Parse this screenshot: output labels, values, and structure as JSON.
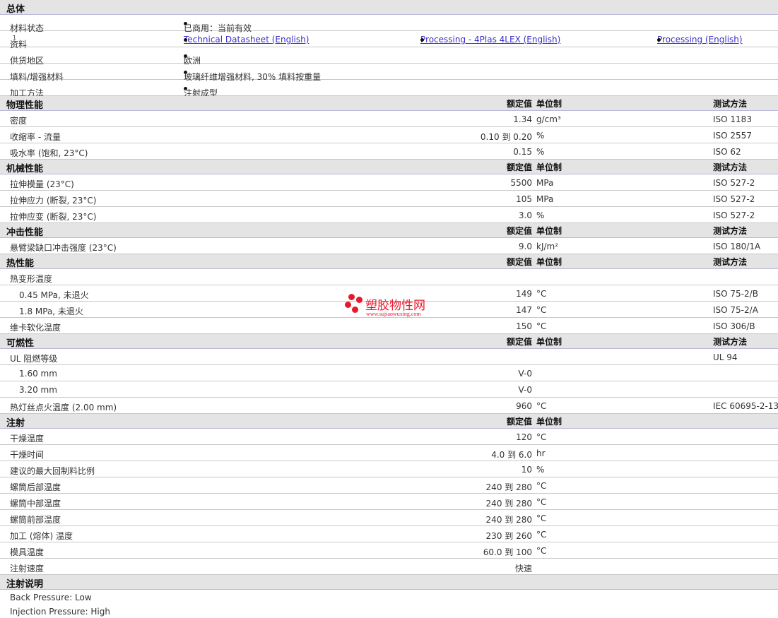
{
  "general": {
    "title": "总体",
    "rows": [
      {
        "label": "材料状态",
        "items": [
          {
            "text": "已商用：当前有效"
          }
        ]
      },
      {
        "label": "资料",
        "sup": "1",
        "items": [
          {
            "text": "Technical Datasheet (English)",
            "link": true
          },
          {
            "text": "Processing - 4Plas 4LEX (English)",
            "link": true
          },
          {
            "text": "Processing (English)",
            "link": true
          }
        ]
      },
      {
        "label": "供货地区",
        "items": [
          {
            "text": "欧洲"
          }
        ]
      },
      {
        "label": "填料/增强材料",
        "items": [
          {
            "text": "玻璃纤维增强材料, 30% 填料按重量"
          }
        ]
      },
      {
        "label": "加工方法",
        "items": [
          {
            "text": "注射成型"
          }
        ]
      }
    ]
  },
  "headers": {
    "value": "额定值",
    "unit": "单位制",
    "method": "测试方法"
  },
  "sections": [
    {
      "title": "物理性能",
      "method": true,
      "rows": [
        {
          "name": "密度",
          "value": "1.34",
          "unit": "g/cm³",
          "method": "ISO 1183"
        },
        {
          "name": "收缩率 - 流量",
          "value": "0.10 到  0.20",
          "unit": "%",
          "method": "ISO 2557"
        },
        {
          "name": "吸水率 (饱和, 23°C)",
          "value": "0.15",
          "unit": "%",
          "method": "ISO 62"
        }
      ]
    },
    {
      "title": "机械性能",
      "method": true,
      "rows": [
        {
          "name": "拉伸模量 (23°C)",
          "value": "5500",
          "unit": "MPa",
          "method": "ISO 527-2"
        },
        {
          "name": "拉伸应力 (断裂, 23°C)",
          "value": "105",
          "unit": "MPa",
          "method": "ISO 527-2"
        },
        {
          "name": "拉伸应变 (断裂, 23°C)",
          "value": "3.0",
          "unit": "%",
          "method": "ISO 527-2"
        }
      ]
    },
    {
      "title": "冲击性能",
      "method": true,
      "rows": [
        {
          "name": "悬臂梁缺口冲击强度 (23°C)",
          "value": "9.0",
          "unit": "kJ/m²",
          "method": "ISO 180/1A"
        }
      ]
    },
    {
      "title": "热性能",
      "method": true,
      "rows": [
        {
          "name": "热变形温度",
          "value": "",
          "unit": "",
          "method": ""
        },
        {
          "name": "0.45 MPa, 未退火",
          "sub": true,
          "value": "149",
          "unit": "°C",
          "method": "ISO 75-2/B"
        },
        {
          "name": "1.8 MPa, 未退火",
          "sub": true,
          "value": "147",
          "unit": "°C",
          "method": "ISO 75-2/A"
        },
        {
          "name": "维卡软化温度",
          "value": "150",
          "unit": "°C",
          "method": "ISO 306/B"
        }
      ]
    },
    {
      "title": "可燃性",
      "method": true,
      "rows": [
        {
          "name": "UL 阻燃等级",
          "value": "",
          "unit": "",
          "method": "UL 94"
        },
        {
          "name": "1.60 mm",
          "sub": true,
          "value": "V-0",
          "unit": "",
          "method": ""
        },
        {
          "name": "3.20 mm",
          "sub": true,
          "value": "V-0",
          "unit": "",
          "method": ""
        },
        {
          "name": "热灯丝点火温度 (2.00 mm)",
          "value": "960",
          "unit": "°C",
          "method": "IEC 60695-2-13"
        }
      ]
    },
    {
      "title": "注射",
      "method": false,
      "rows": [
        {
          "name": "干燥温度",
          "value": "120",
          "unit": "°C",
          "method": ""
        },
        {
          "name": "干燥时间",
          "value": "4.0 到  6.0",
          "unit": "hr",
          "method": ""
        },
        {
          "name": "建议的最大回制料比例",
          "value": "10",
          "unit": "%",
          "method": ""
        },
        {
          "name": "螺筒后部温度",
          "value": "240 到  280",
          "unit": "°C",
          "method": ""
        },
        {
          "name": "螺筒中部温度",
          "value": "240 到  280",
          "unit": "°C",
          "method": ""
        },
        {
          "name": "螺筒前部温度",
          "value": "240 到  280",
          "unit": "°C",
          "method": ""
        },
        {
          "name": "加工 (熔体) 温度",
          "value": "230 到  260",
          "unit": "°C",
          "method": ""
        },
        {
          "name": "模具温度",
          "value": "60.0 到  100",
          "unit": "°C",
          "method": ""
        },
        {
          "name": "注射速度",
          "value": "快速",
          "unit": "",
          "method": ""
        }
      ]
    }
  ],
  "notes": {
    "title": "注射说明",
    "lines": [
      "Back Pressure: Low",
      "Injection Pressure: High"
    ]
  },
  "watermark": {
    "name": "塑胶物性网",
    "url": "www.sujiaowuxing.com"
  }
}
